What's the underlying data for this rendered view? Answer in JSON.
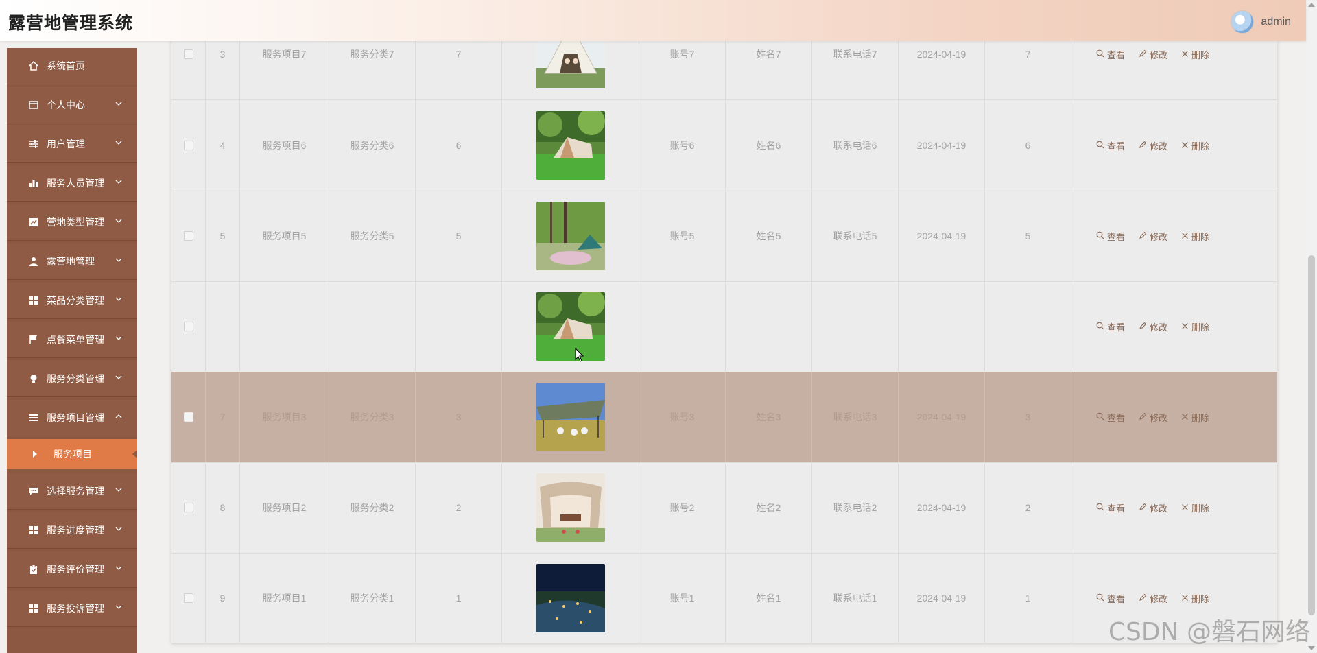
{
  "header": {
    "title": "露营地管理系统",
    "username": "admin"
  },
  "sidebar": {
    "items": [
      {
        "label": "系统首页",
        "icon": "home-icon"
      },
      {
        "label": "个人中心",
        "icon": "wallet-icon",
        "expandable": true
      },
      {
        "label": "用户管理",
        "icon": "sliders-icon",
        "expandable": true
      },
      {
        "label": "服务人员管理",
        "icon": "bar-chart-icon",
        "expandable": true
      },
      {
        "label": "营地类型管理",
        "icon": "line-chart-icon",
        "expandable": true
      },
      {
        "label": "露营地管理",
        "icon": "user-icon",
        "expandable": true
      },
      {
        "label": "菜品分类管理",
        "icon": "grid-icon",
        "expandable": true
      },
      {
        "label": "点餐菜单管理",
        "icon": "flag-icon",
        "expandable": true
      },
      {
        "label": "服务分类管理",
        "icon": "bulb-icon",
        "expandable": true
      },
      {
        "label": "服务项目管理",
        "icon": "list-icon",
        "expandable": true,
        "expanded": true
      },
      {
        "label": "选择服务管理",
        "icon": "chat-icon",
        "expandable": true
      },
      {
        "label": "服务进度管理",
        "icon": "grid-icon",
        "expandable": true
      },
      {
        "label": "服务评价管理",
        "icon": "clipboard-icon",
        "expandable": true
      },
      {
        "label": "服务投诉管理",
        "icon": "grid-icon",
        "expandable": true
      }
    ],
    "active_sub": "服务项目"
  },
  "table": {
    "rows": [
      {
        "index": "3",
        "name": "服务项目7",
        "category": "服务分类7",
        "num": "7",
        "account": "账号7",
        "person": "姓名7",
        "phone": "联系电话7",
        "date": "2024-04-19",
        "count": "7",
        "image": "bell-tent"
      },
      {
        "index": "4",
        "name": "服务项目6",
        "category": "服务分类6",
        "num": "6",
        "account": "账号6",
        "person": "姓名6",
        "phone": "联系电话6",
        "date": "2024-04-19",
        "count": "6",
        "image": "forest-tent"
      },
      {
        "index": "5",
        "name": "服务项目5",
        "category": "服务分类5",
        "num": "5",
        "account": "账号5",
        "person": "姓名5",
        "phone": "联系电话5",
        "date": "2024-04-19",
        "count": "5",
        "image": "green-tent"
      },
      {
        "index": "",
        "name": "",
        "category": "",
        "num": "",
        "account": "",
        "person": "",
        "phone": "",
        "date": "",
        "count": "",
        "image": "forest-tent"
      },
      {
        "index": "7",
        "name": "服务项目3",
        "category": "服务分类3",
        "num": "3",
        "account": "账号3",
        "person": "姓名3",
        "phone": "联系电话3",
        "date": "2024-04-19",
        "count": "3",
        "image": "canopy",
        "selected": true
      },
      {
        "index": "8",
        "name": "服务项目2",
        "category": "服务分类2",
        "num": "2",
        "account": "账号2",
        "person": "姓名2",
        "phone": "联系电话2",
        "date": "2024-04-19",
        "count": "2",
        "image": "glamping"
      },
      {
        "index": "9",
        "name": "服务项目1",
        "category": "服务分类1",
        "num": "1",
        "account": "账号1",
        "person": "姓名1",
        "phone": "联系电话1",
        "date": "2024-04-19",
        "count": "1",
        "image": "night-camp"
      }
    ],
    "actions": {
      "view": "查看",
      "edit": "修改",
      "delete": "删除"
    }
  },
  "watermark": "CSDN @磐石网络",
  "colors": {
    "sidebar": "#8c5841",
    "active": "#e07a46",
    "selected_row": "#c6b0a3"
  }
}
